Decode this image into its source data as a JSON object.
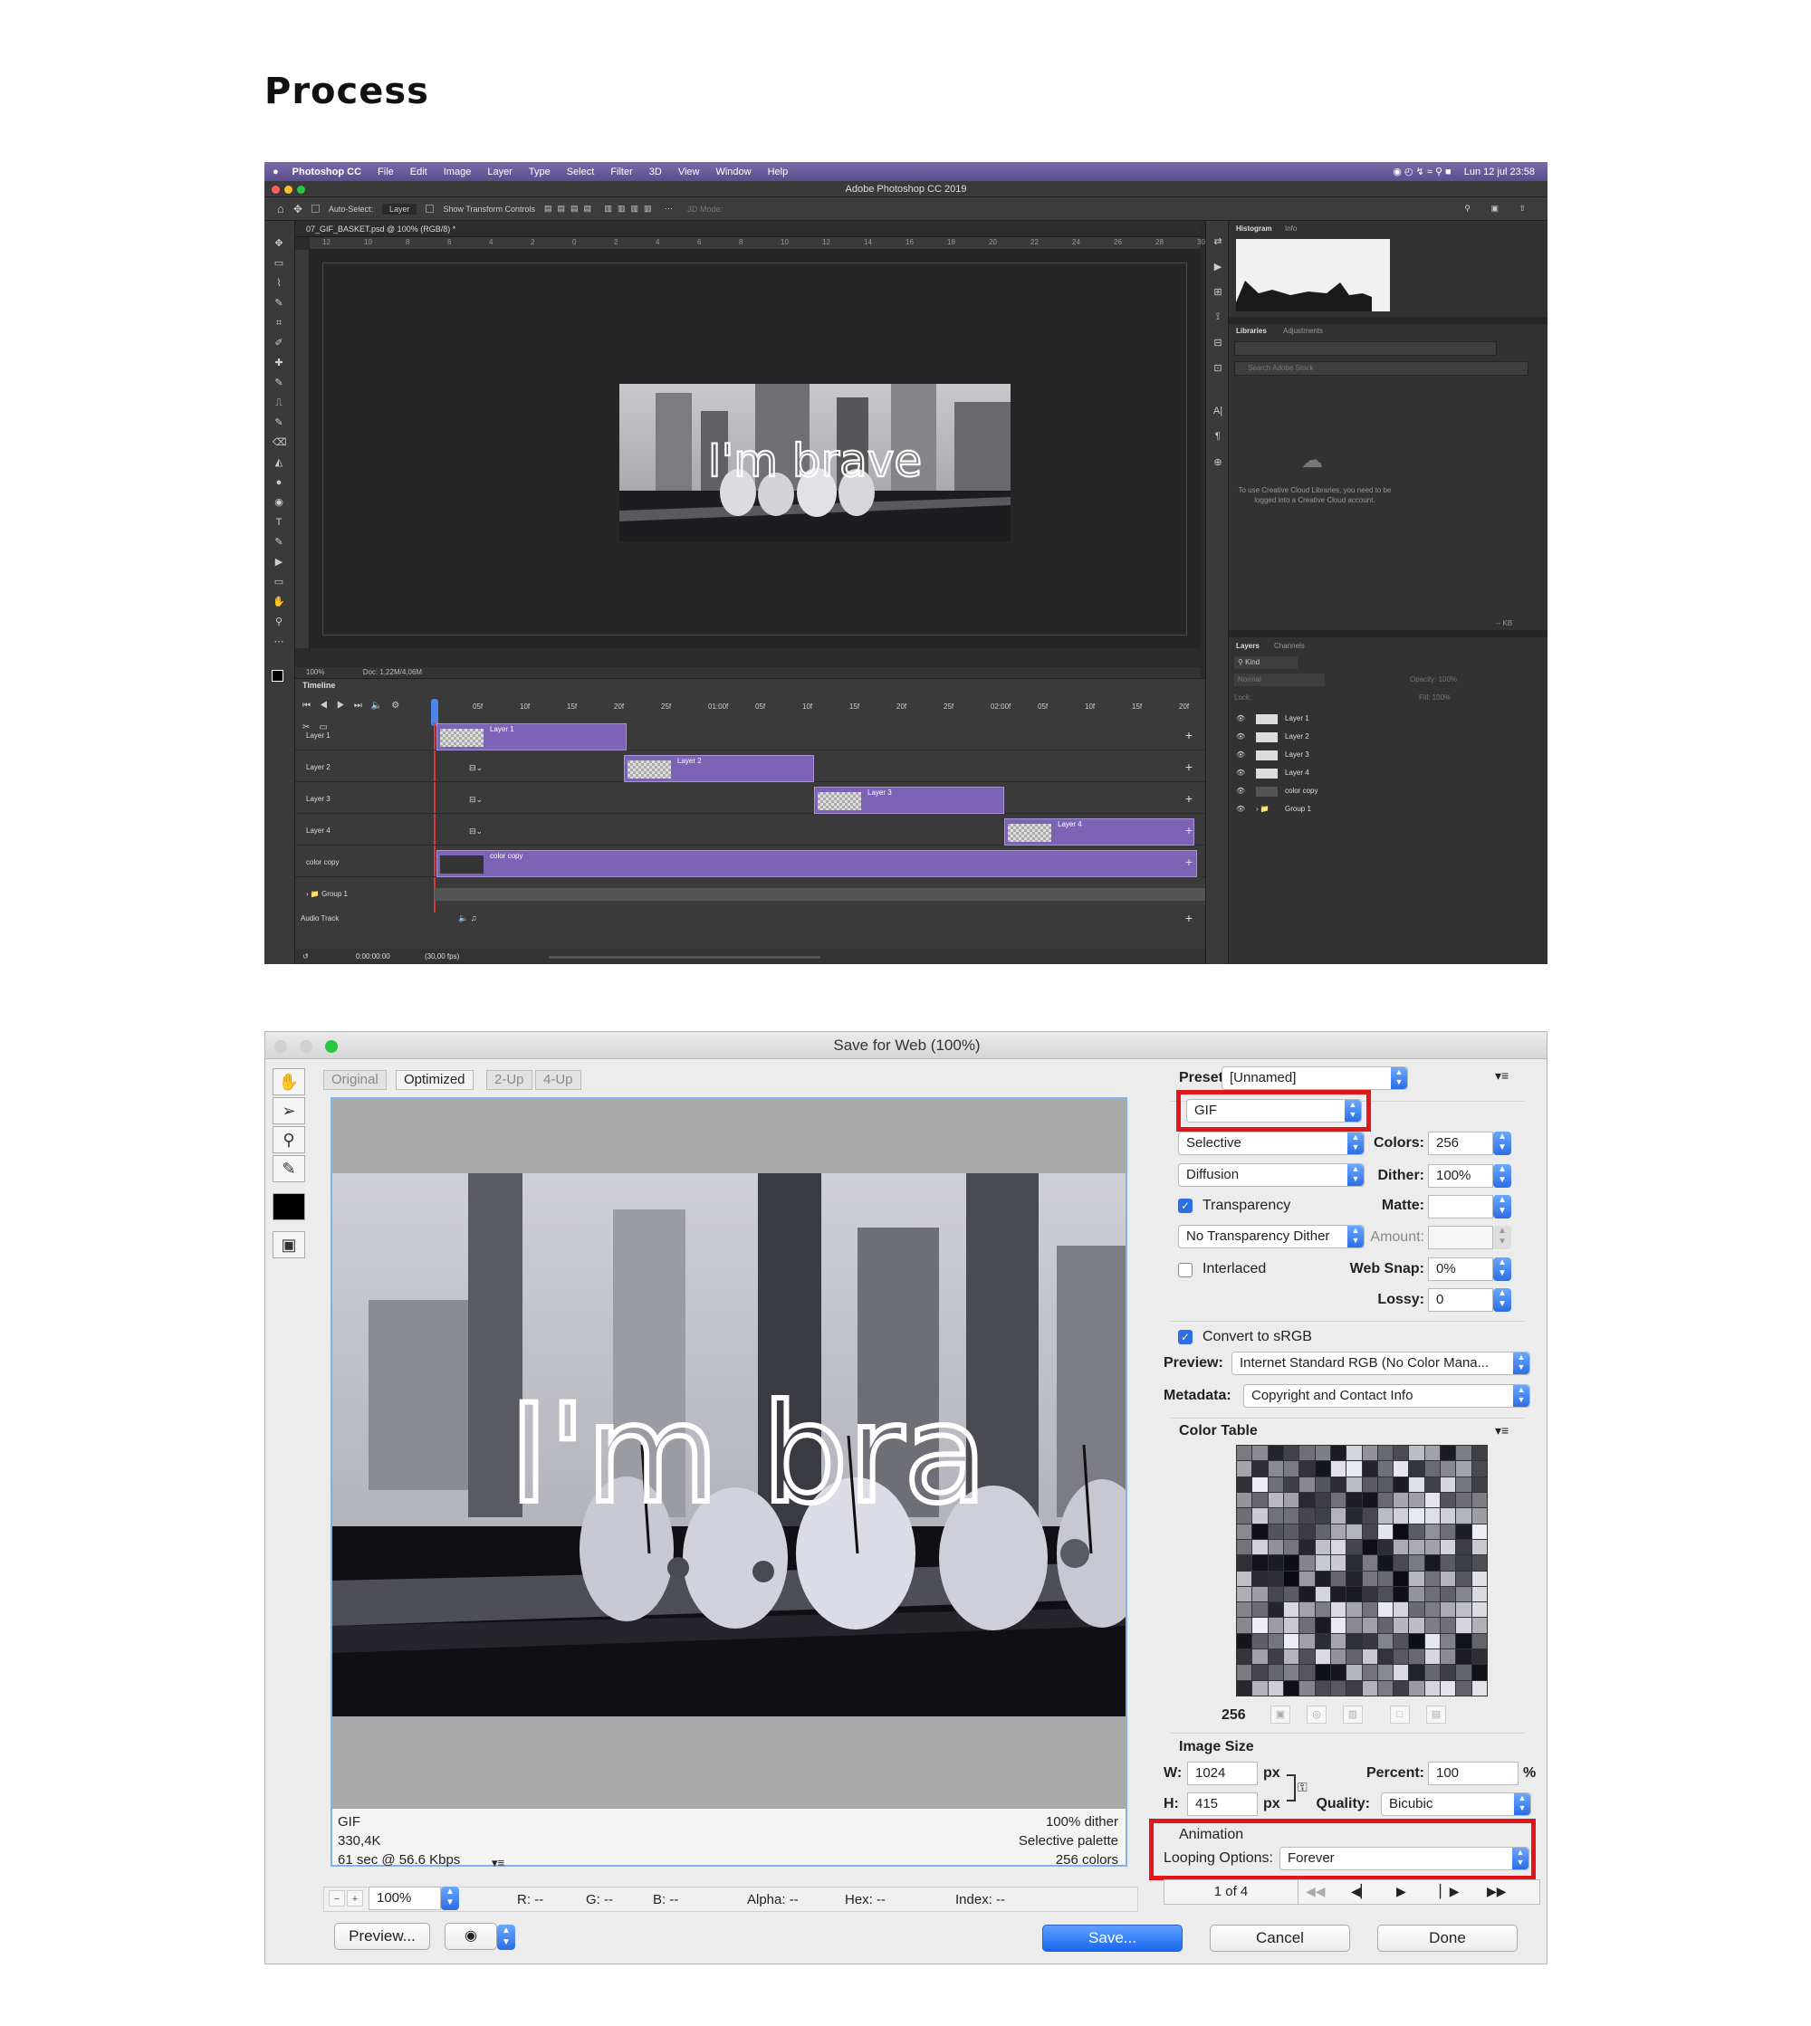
{
  "heading": "Process",
  "photoshop": {
    "menu": {
      "apple": "",
      "app": "Photoshop CC",
      "items": [
        "File",
        "Edit",
        "Image",
        "Layer",
        "Type",
        "Select",
        "Filter",
        "3D",
        "View",
        "Window",
        "Help"
      ],
      "clock": "Lun 12 jul  23:58"
    },
    "window_title": "Adobe Photoshop CC 2019",
    "options_bar": {
      "auto_select": "Auto-Select:",
      "auto_select_value": "Layer",
      "show_transform": "Show Transform Controls",
      "mode_3d": "3D Mode:"
    },
    "document_tab": "07_GIF_BASKET.psd @ 100% (RGB/8) *",
    "ruler_h_ticks": [
      "12",
      "10",
      "8",
      "6",
      "4",
      "2",
      "0",
      "2",
      "4",
      "6",
      "8",
      "10",
      "12",
      "14",
      "16",
      "18",
      "20",
      "22",
      "24",
      "26",
      "28",
      "30"
    ],
    "canvas_text": "I'm brave",
    "status": {
      "zoom": "100%",
      "doc": "Doc: 1,22M/4,06M"
    },
    "timeline": {
      "title": "Timeline",
      "ruler": [
        "05f",
        "10f",
        "15f",
        "20f",
        "25f",
        "01:00f",
        "05f",
        "10f",
        "15f",
        "20f",
        "25f",
        "02:00f",
        "05f",
        "10f",
        "15f",
        "20f"
      ],
      "tracks": [
        {
          "label": "Layer 1",
          "clip": "Layer 1"
        },
        {
          "label": "Layer 2",
          "clip": "Layer 2"
        },
        {
          "label": "Layer 3",
          "clip": "Layer 3"
        },
        {
          "label": "Layer 4",
          "clip": "Layer 4"
        },
        {
          "label": "color copy",
          "clip": "color copy"
        }
      ],
      "group": "Group 1",
      "audio": "Audio Track",
      "timecode": "0:00:00:00",
      "fps": "(30,00 fps)"
    },
    "panels": {
      "histogram_tab": "Histogram",
      "info_tab": "Info",
      "libraries_tab": "Libraries",
      "adjustments_tab": "Adjustments",
      "search_placeholder": "Search Adobe Stock",
      "cc_message": "To use Creative Cloud Libraries, you need to be logged into a Creative Cloud account.",
      "kb": "-- KB",
      "layers_tab": "Layers",
      "channels_tab": "Channels",
      "kind": "Kind",
      "blend": "Normal",
      "opacity": "Opacity: 100%",
      "lock": "Lock:",
      "fill": "Fill: 100%",
      "layers": [
        "Layer 1",
        "Layer 2",
        "Layer 3",
        "Layer 4",
        "color copy",
        "Group 1"
      ]
    }
  },
  "save_for_web": {
    "title": "Save for Web (100%)",
    "tabs": [
      "Original",
      "Optimized",
      "2-Up",
      "4-Up"
    ],
    "active_tab": "Optimized",
    "preview_text": "I'm bra",
    "info_left": [
      "GIF",
      "330,4K",
      "61 sec @ 56.6 Kbps"
    ],
    "info_right": [
      "100% dither",
      "Selective palette",
      "256 colors"
    ],
    "zoom": "100%",
    "readouts": {
      "r": "R: --",
      "g": "G: --",
      "b": "B: --",
      "alpha": "Alpha: --",
      "hex": "Hex: --",
      "index": "Index: --"
    },
    "preset_label": "Preset:",
    "preset_value": "[Unnamed]",
    "format": "GIF",
    "reduction": "Selective",
    "dither_algo": "Diffusion",
    "colors_label": "Colors:",
    "colors_value": "256",
    "dither_label": "Dither:",
    "dither_value": "100%",
    "transparency_label": "Transparency",
    "matte_label": "Matte:",
    "transparency_dither": "No Transparency Dither",
    "amount_label": "Amount:",
    "interlaced_label": "Interlaced",
    "websnap_label": "Web Snap:",
    "websnap_value": "0%",
    "lossy_label": "Lossy:",
    "lossy_value": "0",
    "convert_label": "Convert to sRGB",
    "preview_label": "Preview:",
    "preview_value": "Internet Standard RGB (No Color Mana...",
    "metadata_label": "Metadata:",
    "metadata_value": "Copyright and Contact Info",
    "color_table_label": "Color Table",
    "color_count": "256",
    "image_size_label": "Image Size",
    "w_label": "W:",
    "w_value": "1024",
    "h_label": "H:",
    "h_value": "415",
    "px": "px",
    "percent_label": "Percent:",
    "percent_value": "100",
    "percent_unit": "%",
    "quality_label": "Quality:",
    "quality_value": "Bicubic",
    "animation_label": "Animation",
    "looping_label": "Looping Options:",
    "looping_value": "Forever",
    "frame_counter": "1 of 4",
    "buttons": {
      "preview": "Preview...",
      "save": "Save...",
      "cancel": "Cancel",
      "done": "Done"
    },
    "colors": {
      "highlight": "#e2151b",
      "accent": "#2b6ee6"
    }
  }
}
